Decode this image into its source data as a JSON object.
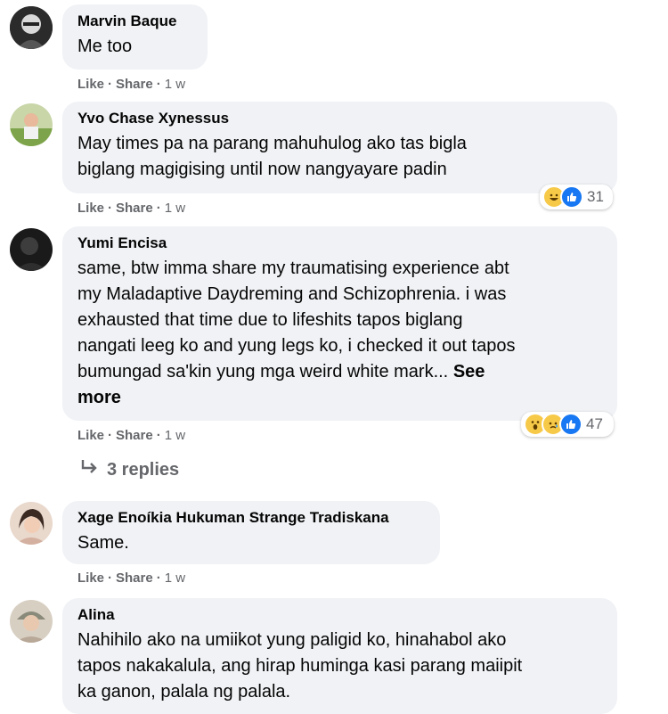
{
  "comments": [
    {
      "author": "Marvin Baque",
      "text": "Me too",
      "actions": {
        "like": "Like",
        "share": "Share",
        "time": "1 w"
      }
    },
    {
      "author": "Yvo Chase Xynessus",
      "lines": [
        "May times pa na parang mahuhulog ako tas bigla",
        "biglang magigising until now nangyayare padin"
      ],
      "actions": {
        "like": "Like",
        "share": "Share",
        "time": "1 w"
      },
      "reactions": {
        "count": "31",
        "icons": [
          "haha-icon",
          "like-icon"
        ]
      }
    },
    {
      "author": "Yumi Encisa",
      "lines": [
        "same, btw imma share my traumatising experience abt",
        "my Maladaptive Daydreming and Schizophrenia. i was",
        "exhausted that time due to lifeshits tapos biglang",
        "nangati leeg ko and yung legs ko, i checked it out tapos",
        "bumungad sa'kin yung mga weird white mark..."
      ],
      "see_more_a": "See",
      "see_more_b": "more",
      "actions": {
        "like": "Like",
        "share": "Share",
        "time": "1 w"
      },
      "reactions": {
        "count": "47",
        "icons": [
          "wow-icon",
          "sad-icon",
          "like-icon"
        ]
      },
      "replies": "3 replies"
    },
    {
      "author": "Xage Enoíkia Hukuman Strange Tradiskana",
      "text": "Same.",
      "actions": {
        "like": "Like",
        "share": "Share",
        "time": "1 w"
      }
    },
    {
      "author": "Alina",
      "lines": [
        "Nahihilo ako na umiikot yung paligid ko, hinahabol ako",
        "tapos nakakalula, ang hirap huminga kasi parang maiipit",
        "ka ganon, palala ng palala."
      ]
    }
  ],
  "separator": "·",
  "colors": {
    "bubble": "#f0f2f5",
    "meta": "#65676b",
    "like_blue": "#1877f2",
    "reaction_yellow": "#f7c948"
  }
}
